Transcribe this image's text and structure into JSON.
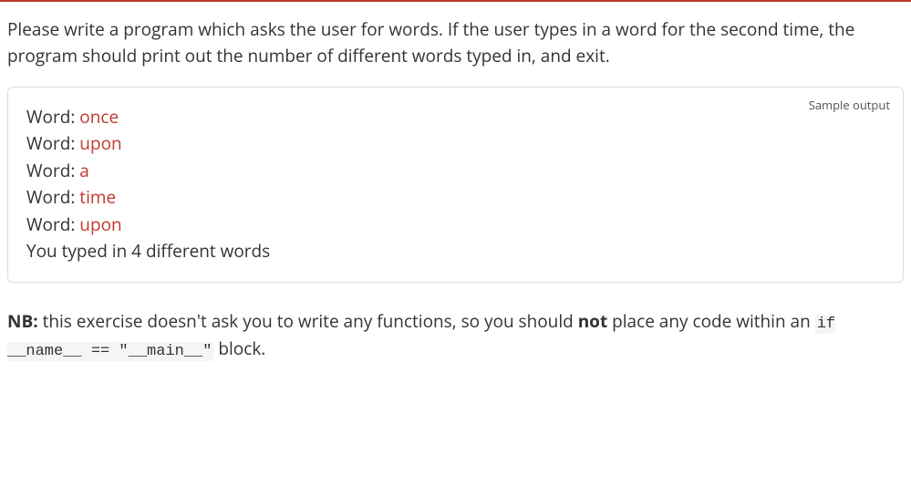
{
  "description": "Please write a program which asks the user for words. If the user types in a word for the second time, the program should print out the number of different words typed in, and exit.",
  "sample": {
    "label": "Sample output",
    "lines": [
      {
        "prompt": "Word: ",
        "input": "once"
      },
      {
        "prompt": "Word: ",
        "input": "upon"
      },
      {
        "prompt": "Word: ",
        "input": "a"
      },
      {
        "prompt": "Word: ",
        "input": "time"
      },
      {
        "prompt": "Word: ",
        "input": "upon"
      }
    ],
    "result": "You typed in 4 different words"
  },
  "note": {
    "prefix_bold": "NB:",
    "text_before_not": " this exercise doesn't ask you to write any functions, so you should ",
    "not_bold": "not",
    "text_after_not": " place any code within an ",
    "code": "if __name__ == \"__main__\"",
    "text_after_code": " block."
  }
}
